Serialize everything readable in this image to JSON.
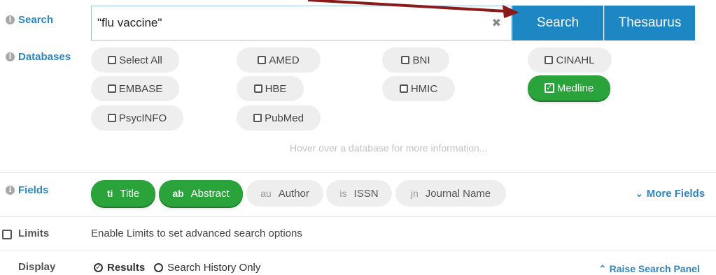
{
  "search": {
    "label": "Search",
    "query": "\"flu vaccine\"",
    "clear_symbol": "✖",
    "search_button": "Search",
    "thesaurus_button": "Thesaurus"
  },
  "databases": {
    "label": "Databases",
    "items": [
      {
        "label": "Select All",
        "selected": false
      },
      {
        "label": "AMED",
        "selected": false
      },
      {
        "label": "BNI",
        "selected": false
      },
      {
        "label": "CINAHL",
        "selected": false
      },
      {
        "label": "EMBASE",
        "selected": false
      },
      {
        "label": "HBE",
        "selected": false
      },
      {
        "label": "HMIC",
        "selected": false
      },
      {
        "label": "Medline",
        "selected": true
      },
      {
        "label": "PsycINFO",
        "selected": false
      },
      {
        "label": "PubMed",
        "selected": false
      }
    ],
    "hover_hint": "Hover over a database for more information..."
  },
  "fields": {
    "label": "Fields",
    "items": [
      {
        "abbr": "ti",
        "label": "Title",
        "selected": true
      },
      {
        "abbr": "ab",
        "label": "Abstract",
        "selected": true
      },
      {
        "abbr": "au",
        "label": "Author",
        "selected": false
      },
      {
        "abbr": "is",
        "label": "ISSN",
        "selected": false
      },
      {
        "abbr": "jn",
        "label": "Journal Name",
        "selected": false
      }
    ],
    "more_fields": "More Fields",
    "more_fields_icon": "chevron-down-icon"
  },
  "limits": {
    "label": "Limits",
    "description": "Enable Limits to set advanced search options"
  },
  "display": {
    "label": "Display",
    "options": [
      {
        "label": "Results",
        "selected": true
      },
      {
        "label": "Search History Only",
        "selected": false
      }
    ],
    "raise_panel": "Raise Search Panel",
    "raise_panel_icon": "chevron-up-icon"
  },
  "colors": {
    "accent_blue": "#1d87c4",
    "selected_green": "#2aa33a",
    "label_blue": "#2e86c1",
    "annotation_arrow": "#8b1a1a"
  }
}
